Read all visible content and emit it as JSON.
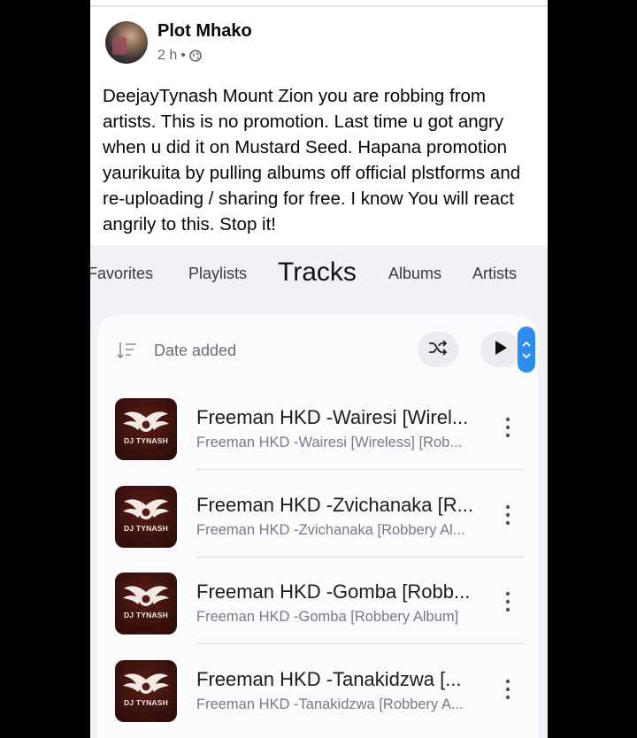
{
  "post": {
    "author": "Plot Mhako",
    "time": "2 h",
    "dot": "•",
    "text": "DeejayTynash Mount Zion you are robbing from artists. This is no promotion. Last time u got angry when u did it on Mustard Seed. Hapana promotion yaurikuita by pulling albums off official plstforms and re-uploading / sharing for free. I know You will react angrily to this. Stop it!"
  },
  "music_app": {
    "tabs": [
      {
        "label": "Favorites"
      },
      {
        "label": "Playlists"
      },
      {
        "label": "Tracks"
      },
      {
        "label": "Albums"
      },
      {
        "label": "Artists"
      }
    ],
    "sort": {
      "label": "Date added"
    },
    "thumb_brand": "DJ TYNASH",
    "tracks": [
      {
        "title": "Freeman HKD -Wairesi [Wirel...",
        "subtitle": "Freeman HKD -Wairesi [Wireless] [Rob..."
      },
      {
        "title": "Freeman HKD -Zvichanaka [R...",
        "subtitle": "Freeman HKD -Zvichanaka [Robbery Al..."
      },
      {
        "title": "Freeman HKD -Gomba [Robb...",
        "subtitle": "Freeman HKD -Gomba [Robbery Album]"
      },
      {
        "title": "Freeman HKD -Tanakidzwa [...",
        "subtitle": "Freeman HKD -Tanakidzwa [Robbery A..."
      }
    ]
  },
  "icons": {
    "privacy": "globe-icon",
    "sort": "sort-descending-icon",
    "shuffle": "shuffle-icon",
    "play": "play-icon",
    "more": "more-vertical-icon"
  },
  "colors": {
    "accent": "#2d8cf0",
    "thumb_bg": "#3d130e"
  }
}
